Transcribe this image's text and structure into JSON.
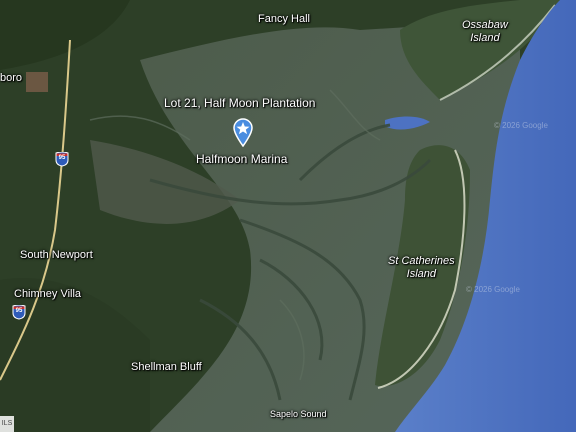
{
  "map": {
    "places": {
      "fancy_hall": "Fancy Hall",
      "ossabaw_island": "Ossabaw\nIsland",
      "riceboro_partial": "boro",
      "marker_title": "Lot 21, Half Moon Plantation",
      "halfmoon_marina": "Halfmoon Marina",
      "south_newport": "South Newport",
      "chimney_villa": "Chimney Villa",
      "st_catherines_island": "St Catherines\nIsland",
      "shellman_bluff": "Shellman Bluff",
      "sapelo_sound": "Sapelo Sound"
    },
    "highway": {
      "number_top": "95",
      "number_bottom": "95"
    },
    "watermarks": [
      "© 2026 Google",
      "© 2026 Google"
    ],
    "corner_badge": "ILS",
    "colors": {
      "ocean": "#4d72c2",
      "marsh": "#4a5a4a",
      "forest": "#2c3d26",
      "pin": "#4a8de0",
      "road": "#d9c88a"
    },
    "icons": {
      "pin": "map-pin-star-icon",
      "shield": "interstate-shield-icon"
    }
  }
}
